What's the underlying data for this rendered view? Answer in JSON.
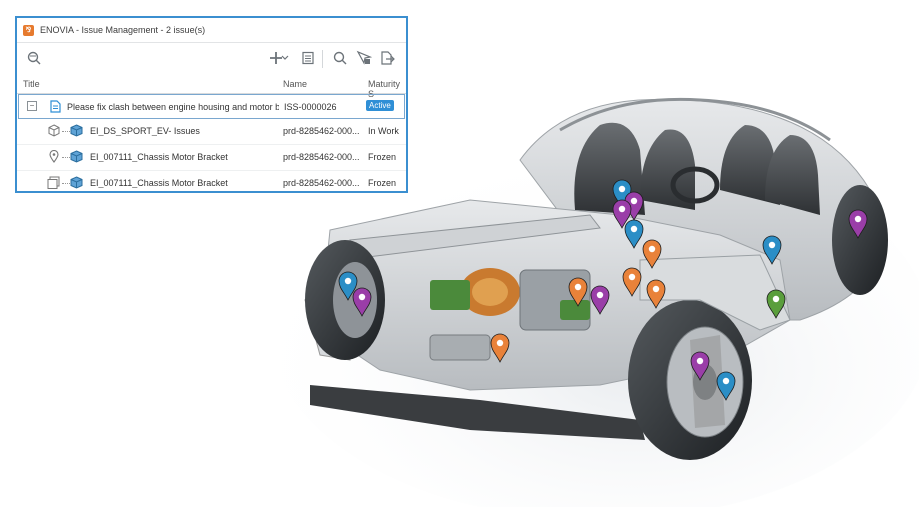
{
  "window": {
    "title": "ENOVIA - Issue Management - 2 issue(s)",
    "app_icon": "3ds-compass-icon"
  },
  "toolbar": {
    "icons": [
      "search-filter-icon",
      "add-icon",
      "chevron-down-icon",
      "list-view-icon",
      "search-icon",
      "select-cursor-icon",
      "export-icon"
    ]
  },
  "table": {
    "columns": [
      "Title",
      "Name",
      "Maturity S"
    ],
    "rows": [
      {
        "title": "Please fix clash between engine housing and motor b",
        "name": "ISS-0000026",
        "maturity": "Active",
        "type": "issue",
        "expanded": true
      },
      {
        "title": "EI_DS_SPORT_EV- Issues",
        "name": "prd-8285462-000...",
        "maturity": "In Work",
        "type": "product"
      },
      {
        "title": "EI_007111_Chassis Motor Bracket",
        "name": "prd-8285462-000...",
        "maturity": "Frozen",
        "type": "pinned-part"
      },
      {
        "title": "EI_007111_Chassis Motor Bracket",
        "name": "prd-8285462-000...",
        "maturity": "Frozen",
        "type": "capture"
      }
    ],
    "expander_symbol": "−"
  },
  "viewport": {
    "colors": {
      "blue_pin": "#2b8ec6",
      "purple_pin": "#9a3ea8",
      "orange_pin": "#e9823a",
      "green_pin": "#5a9e3c",
      "accent": "#3b8fd0"
    }
  }
}
